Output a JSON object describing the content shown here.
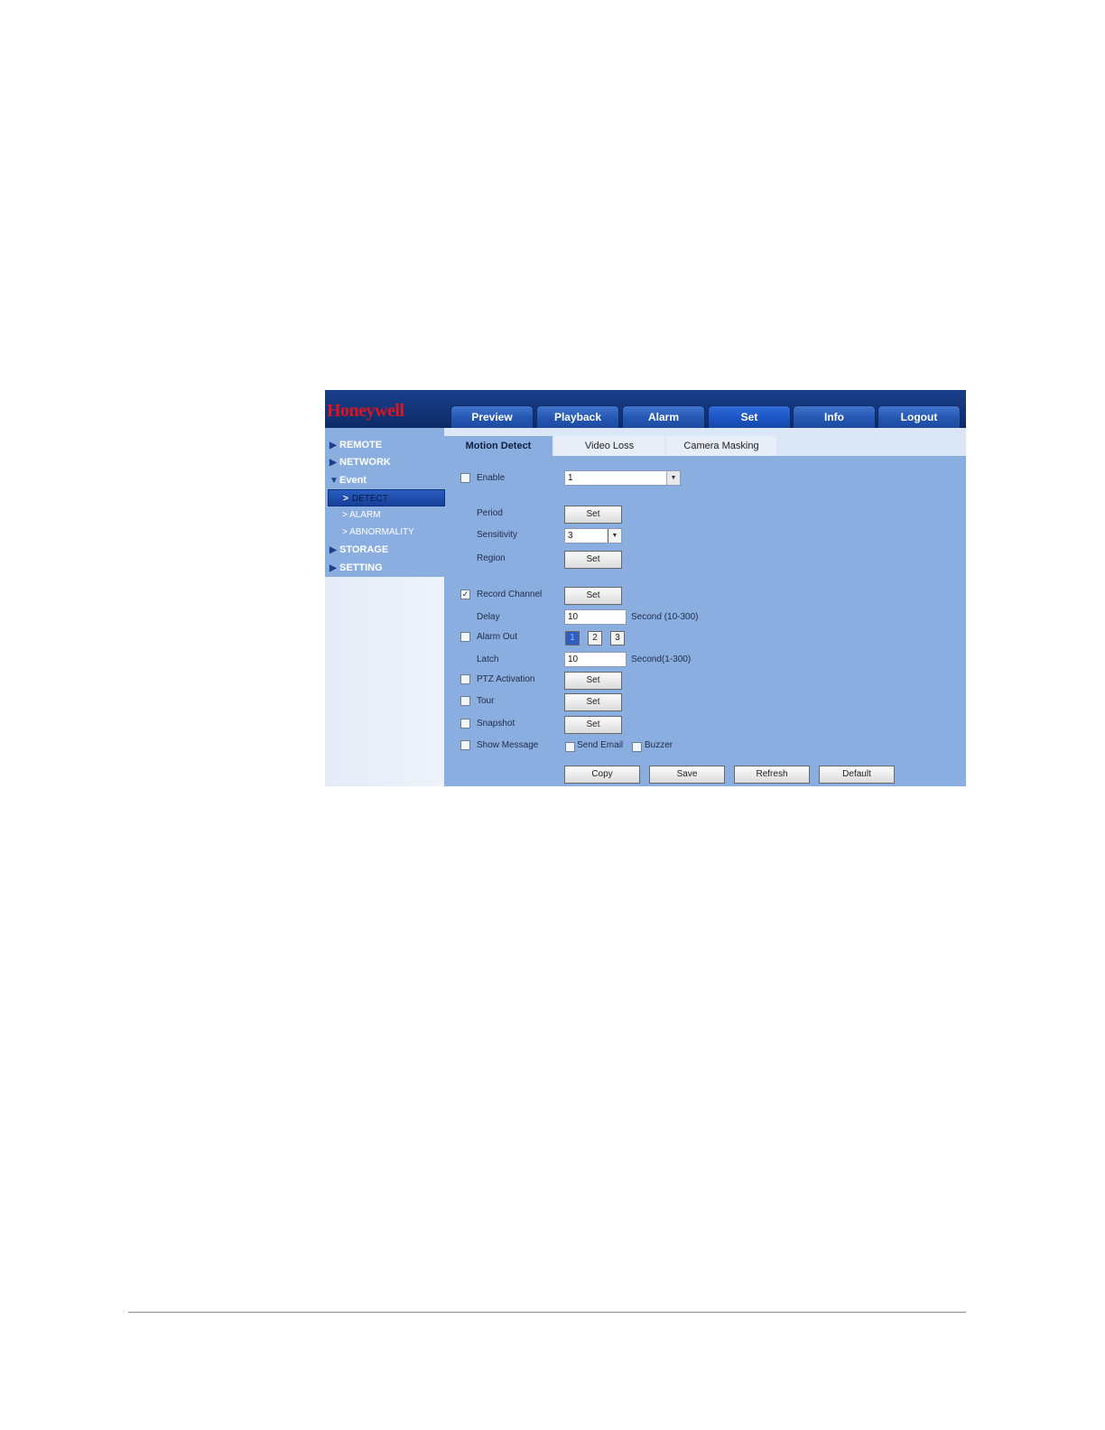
{
  "app": {
    "logo": "Honeywell"
  },
  "nav": [
    {
      "label": "Preview"
    },
    {
      "label": "Playback"
    },
    {
      "label": "Alarm"
    },
    {
      "label": "Set"
    },
    {
      "label": "Info"
    },
    {
      "label": "Logout"
    }
  ],
  "sidebar": {
    "remote": "REMOTE",
    "network": "NETWORK",
    "event": "Event",
    "detect": "DETECT",
    "alarm": "ALARM",
    "abnormality": "ABNORMALITY",
    "storage": "STORAGE",
    "setting": "SETTING"
  },
  "tabs": [
    {
      "label": "Motion Detect"
    },
    {
      "label": "Video Loss"
    },
    {
      "label": "Camera Masking"
    }
  ],
  "form": {
    "enable_label": "Enable",
    "channel_value": "1",
    "period_label": "Period",
    "sensitivity_label": "Sensitivity",
    "sensitivity_value": "3",
    "region_label": "Region",
    "record_channel_label": "Record Channel",
    "record_channel_checked": true,
    "delay_label": "Delay",
    "delay_value": "10",
    "delay_unit": "Second (10-300)",
    "alarm_out_label": "Alarm Out",
    "alarm_out_channels": [
      "1",
      "2",
      "3"
    ],
    "latch_label": "Latch",
    "latch_value": "10",
    "latch_unit": "Second(1-300)",
    "ptz_label": "PTZ Activation",
    "tour_label": "Tour",
    "snapshot_label": "Snapshot",
    "show_message_label": "Show Message",
    "send_email_label": "Send Email",
    "buzzer_label": "Buzzer",
    "set_label": "Set"
  },
  "actions": {
    "copy": "Copy",
    "save": "Save",
    "refresh": "Refresh",
    "default": "Default"
  },
  "colors": {
    "panel_bg": "#8aaee0",
    "topbar_bg": "#123376",
    "logo": "#e0141e"
  }
}
